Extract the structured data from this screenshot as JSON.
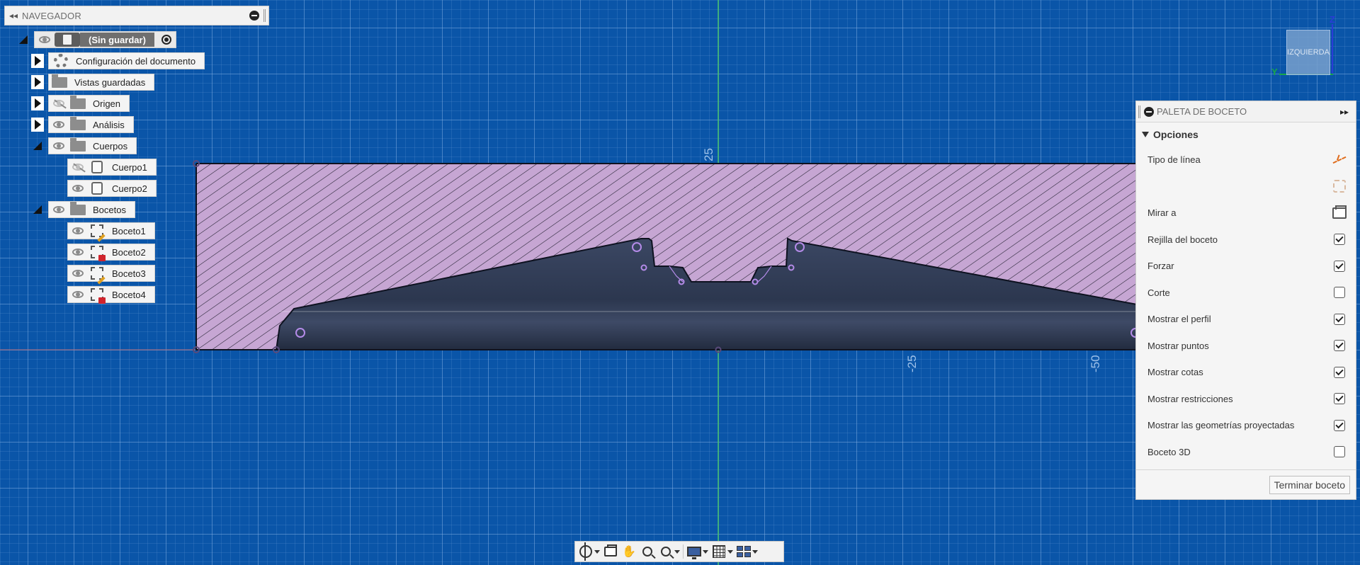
{
  "navigator": {
    "title": "NAVEGADOR",
    "root_label": "(Sin guardar)",
    "items": [
      {
        "label": "Configuración del documento",
        "icon": "gear-icon"
      },
      {
        "label": "Vistas guardadas",
        "icon": "folder-icon"
      },
      {
        "label": "Origen",
        "icon": "folder-icon",
        "visible": false
      },
      {
        "label": "Análisis",
        "icon": "folder-icon"
      },
      {
        "label": "Cuerpos",
        "icon": "folder-icon",
        "expanded": true
      },
      {
        "label": "Cuerpo1",
        "icon": "body-icon",
        "visible": false
      },
      {
        "label": "Cuerpo2",
        "icon": "body-icon"
      },
      {
        "label": "Bocetos",
        "icon": "folder-icon",
        "expanded": true
      },
      {
        "label": "Boceto1",
        "icon": "sketch-edit-icon"
      },
      {
        "label": "Boceto2",
        "icon": "sketch-locked-icon"
      },
      {
        "label": "Boceto3",
        "icon": "sketch-edit-icon"
      },
      {
        "label": "Boceto4",
        "icon": "sketch-locked-icon"
      }
    ]
  },
  "viewcube": {
    "face_label": "IZQUIERDA",
    "axis_z": "Z",
    "axis_y": "Y"
  },
  "canvas": {
    "dimension_labels": [
      "25",
      "-25",
      "-50"
    ],
    "colors": {
      "background": "#0a55a8",
      "profile_fill": "#c6a6d3",
      "body_fill": "#2b3650",
      "sketch_point": "#b48be8",
      "axis_green": "#45c26a"
    }
  },
  "palette": {
    "title": "PALETA DE BOCETO",
    "section_title": "Opciones",
    "options": [
      {
        "label": "Tipo de línea",
        "control": "linetype-icon"
      },
      {
        "label": "",
        "control": "linetype-dim-icon"
      },
      {
        "label": "Mirar a",
        "control": "look-at-icon"
      },
      {
        "label": "Rejilla del boceto",
        "checked": true
      },
      {
        "label": "Forzar",
        "checked": true
      },
      {
        "label": "Corte",
        "checked": false
      },
      {
        "label": "Mostrar el perfil",
        "checked": true
      },
      {
        "label": "Mostrar puntos",
        "checked": true
      },
      {
        "label": "Mostrar cotas",
        "checked": true
      },
      {
        "label": "Mostrar restricciones",
        "checked": true
      },
      {
        "label": "Mostrar las geometrías proyectadas",
        "checked": true
      },
      {
        "label": "Boceto 3D",
        "checked": false
      }
    ],
    "finish_label": "Terminar boceto"
  },
  "toolbar": {
    "buttons": [
      "orbit-icon",
      "look-at-icon",
      "pan-icon",
      "zoom-icon",
      "fit-icon",
      "display-settings-icon",
      "grid-settings-icon",
      "viewports-icon"
    ]
  }
}
